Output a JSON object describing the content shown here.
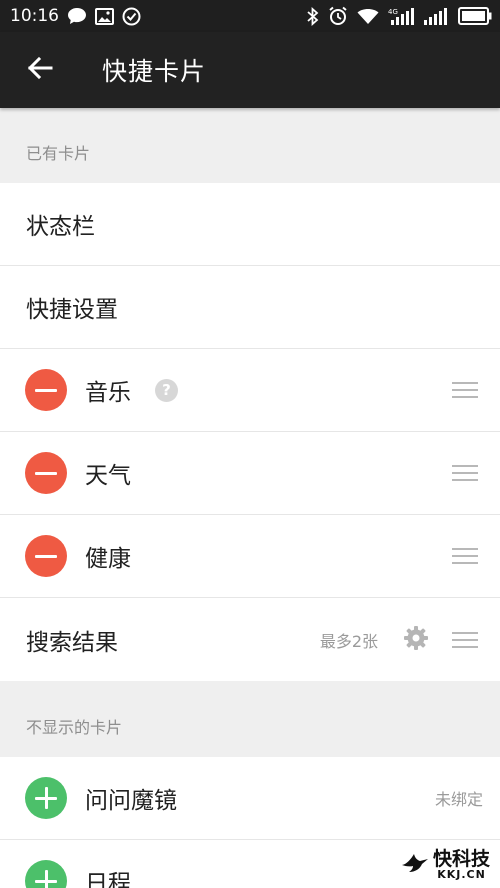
{
  "status_bar": {
    "time": "10:16",
    "network_label": "4G",
    "icons_left": [
      "message-icon",
      "image-icon",
      "check-circle-icon"
    ],
    "icons_right": [
      "bluetooth-icon",
      "alarm-icon",
      "wifi-icon",
      "cellular-4g-icon",
      "cellular-icon",
      "battery-icon"
    ]
  },
  "app_bar": {
    "back_icon": "arrow-back-icon",
    "title": "快捷卡片"
  },
  "existing_section": {
    "header": "已有卡片",
    "items": [
      {
        "label": "状态栏"
      },
      {
        "label": "快捷设置"
      },
      {
        "label": "音乐",
        "action": "remove",
        "help": "?"
      },
      {
        "label": "天气",
        "action": "remove"
      },
      {
        "label": "健康",
        "action": "remove"
      },
      {
        "label": "搜索结果",
        "note": "最多2张",
        "settings_icon": "gear-icon"
      }
    ]
  },
  "hidden_section": {
    "header": "不显示的卡片",
    "items": [
      {
        "label": "问问魔镜",
        "action": "add",
        "note": "未绑定"
      },
      {
        "label": "日程",
        "action": "add"
      }
    ]
  },
  "watermark": {
    "cn": "快科技",
    "en": "KKJ.CN"
  },
  "colors": {
    "app_bar": "#222222",
    "remove": "#ef5a43",
    "add": "#4cc06a",
    "background": "#efefef"
  }
}
